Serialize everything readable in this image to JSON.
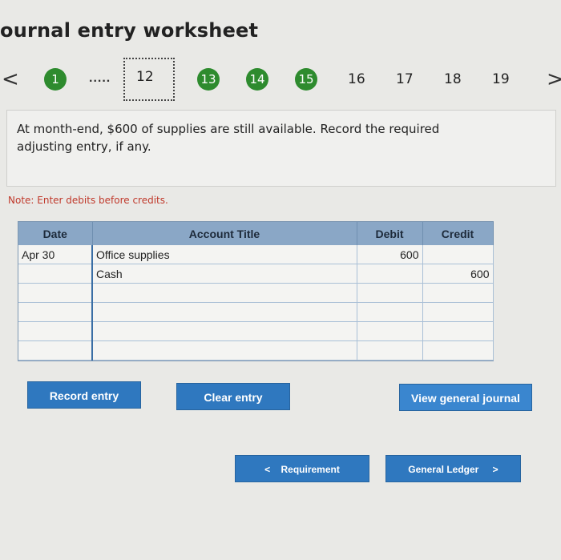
{
  "title": "ournal entry worksheet",
  "nav": {
    "prev_icon": "chevron-left-icon",
    "next_icon": "chevron-right-icon",
    "prev_glyph": "<",
    "next_glyph": ">",
    "dots": ".....",
    "completed_steps": [
      "1",
      "13",
      "14",
      "15"
    ],
    "current_step": "12",
    "remaining_steps": [
      "16",
      "17",
      "18",
      "19"
    ]
  },
  "prompt": "At month-end, $600 of supplies are still available. Record the required adjusting entry, if any.",
  "note": "Note: Enter debits before credits.",
  "journal": {
    "headers": {
      "date": "Date",
      "account": "Account Title",
      "debit": "Debit",
      "credit": "Credit"
    },
    "rows": [
      {
        "date": "Apr 30",
        "account": "Office supplies",
        "debit": "600",
        "credit": ""
      },
      {
        "date": "",
        "account": "Cash",
        "debit": "",
        "credit": "600"
      },
      {
        "date": "",
        "account": "",
        "debit": "",
        "credit": ""
      },
      {
        "date": "",
        "account": "",
        "debit": "",
        "credit": ""
      },
      {
        "date": "",
        "account": "",
        "debit": "",
        "credit": ""
      },
      {
        "date": "",
        "account": "",
        "debit": "",
        "credit": ""
      }
    ]
  },
  "buttons": {
    "record": "Record entry",
    "clear": "Clear entry",
    "view_journal": "View general journal",
    "requirement": "Requirement",
    "general_ledger": "General Ledger"
  },
  "colors": {
    "step_complete": "#2e8b2e",
    "button": "#2f78bf",
    "header": "#8aa7c6",
    "note": "#c0392b"
  }
}
